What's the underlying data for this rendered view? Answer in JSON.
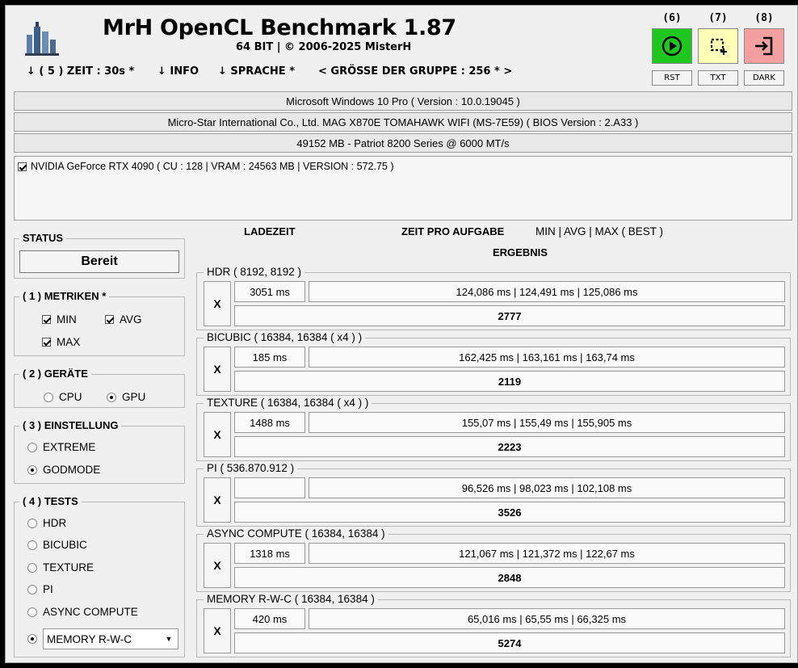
{
  "app": {
    "title": "MrH OpenCL Benchmark 1.87",
    "subtitle": "64 BIT | ©  2006-2025 MisterH"
  },
  "menu": {
    "zeit": "↓ ( 5 ) ZEIT : 30s *",
    "info": "↓ INFO",
    "sprache": "↓ SPRACHE *",
    "gruppe": "< GRÖSSE DER GRUPPE : 256 * >"
  },
  "toolbar": {
    "run": {
      "num": "(6)",
      "label": "RST",
      "color": "#1fc81f"
    },
    "txt": {
      "num": "(7)",
      "label": "TXT",
      "color": "#ffffb8"
    },
    "dark": {
      "num": "(8)",
      "label": "DARK",
      "color": "#f5a0a0"
    }
  },
  "system": {
    "os": "Microsoft Windows 10 Pro ( Version : 10.0.19045 )",
    "board": "Micro-Star International Co., Ltd. MAG X870E TOMAHAWK WIFI (MS-7E59) ( BIOS Version : 2.A33 )",
    "memory": "49152 MB - Patriot 8200 Series @ 6000 MT/s"
  },
  "devices": [
    {
      "label": "NVIDIA GeForce RTX 4090 ( CU : 128 | VRAM : 24563 MB | VERSION : 572.75 )",
      "checked": true
    }
  ],
  "status": {
    "group": "STATUS",
    "value": "Bereit"
  },
  "metrics": {
    "group": "( 1 ) METRIKEN *",
    "min": "MIN",
    "avg": "AVG",
    "max": "MAX"
  },
  "devtype": {
    "group": "( 2 ) GERÄTE",
    "cpu": "CPU",
    "gpu": "GPU",
    "selected": "GPU"
  },
  "setting": {
    "group": "( 3 ) EINSTELLUNG",
    "extreme": "EXTREME",
    "godmode": "GODMODE",
    "selected": "GODMODE"
  },
  "tests_group": {
    "group": "( 4 ) TESTS",
    "items": [
      "HDR",
      "BICUBIC",
      "TEXTURE",
      "PI",
      "ASYNC COMPUTE"
    ],
    "dropdown_value": "MEMORY R-W-C"
  },
  "columns": {
    "load": "LADEZEIT",
    "time": "ZEIT PRO AUFGABE",
    "minavgmax": "MIN | AVG | MAX ( BEST )",
    "result": "ERGEBNIS"
  },
  "results": [
    {
      "title": "HDR ( 8192, 8192 )",
      "x": "X",
      "load": "3051 ms",
      "times": "124,086 ms | 124,491 ms | 125,086 ms",
      "score": "2777"
    },
    {
      "title": "BICUBIC ( 16384, 16384 ( x4 ) )",
      "x": "X",
      "load": "185 ms",
      "times": "162,425 ms | 163,161 ms | 163,74 ms",
      "score": "2119"
    },
    {
      "title": "TEXTURE ( 16384, 16384 ( x4 ) )",
      "x": "X",
      "load": "1488 ms",
      "times": "155,07 ms | 155,49 ms | 155,905 ms",
      "score": "2223"
    },
    {
      "title": "PI ( 536.870.912 )",
      "x": "X",
      "load": "",
      "times": "96,526 ms | 98,023 ms | 102,108 ms",
      "score": "3526"
    },
    {
      "title": "ASYNC COMPUTE ( 16384, 16384 )",
      "x": "X",
      "load": "1318 ms",
      "times": "121,067 ms | 121,372 ms | 122,67 ms",
      "score": "2848"
    },
    {
      "title": "MEMORY R-W-C ( 16384, 16384 )",
      "x": "X",
      "load": "420 ms",
      "times": "65,016 ms | 65,55 ms | 66,325 ms",
      "score": "5274"
    }
  ]
}
